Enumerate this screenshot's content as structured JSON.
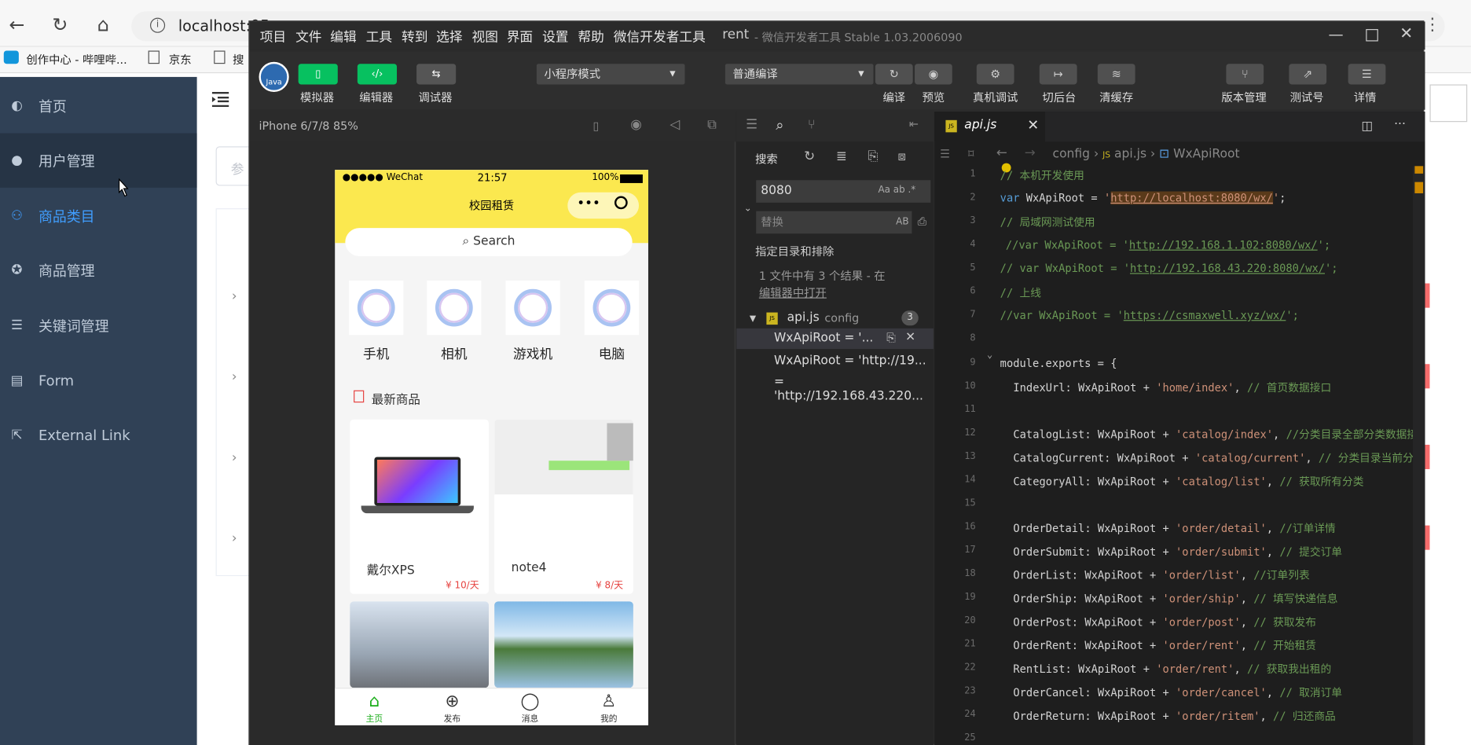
{
  "browser": {
    "url": "localhost:95",
    "bookmarks": [
      "创作中心 - 哔哩哔...",
      "京东",
      "搜"
    ]
  },
  "admin": {
    "sidebar": [
      {
        "label": "首页",
        "icon": "dashboard-icon"
      },
      {
        "label": "用户管理",
        "icon": "user-icon"
      },
      {
        "label": "商品类目",
        "icon": "tree-icon"
      },
      {
        "label": "商品管理",
        "icon": "goods-icon"
      },
      {
        "label": "关键词管理",
        "icon": "list-icon"
      },
      {
        "label": "Form",
        "icon": "form-icon"
      },
      {
        "label": "External Link",
        "icon": "link-icon"
      }
    ],
    "active_index": 2,
    "hover_index": 1,
    "search_placeholder": "参"
  },
  "devtools": {
    "menus": [
      "项目",
      "文件",
      "编辑",
      "工具",
      "转到",
      "选择",
      "视图",
      "界面",
      "设置",
      "帮助",
      "微信开发者工具"
    ],
    "title": "rent",
    "title_suffix": "- 微信开发者工具 Stable 1.03.2006090",
    "toolbar": {
      "simulator": "模拟器",
      "editor": "编辑器",
      "debugger": "调试器",
      "mode": "小程序模式",
      "compile": "普通编译",
      "compile_btn": "编译",
      "preview": "预览",
      "real_debug": "真机调试",
      "background": "切后台",
      "clear_cache": "清缓存",
      "version": "版本管理",
      "test": "测试号",
      "details": "详情"
    },
    "device": "iPhone 6/7/8 85%"
  },
  "phone": {
    "carrier": "●●●●● WeChat",
    "time": "21:57",
    "battery": "100%",
    "title": "校园租赁",
    "search": "Search",
    "categories": [
      "手机",
      "相机",
      "游戏机",
      "电脑"
    ],
    "section_title": "最新商品",
    "products": [
      {
        "name": "戴尔XPS",
        "price": "¥ 10/天"
      },
      {
        "name": "note4",
        "price": "¥ 8/天"
      }
    ],
    "tabs": [
      "主页",
      "发布",
      "消息",
      "我的"
    ]
  },
  "search": {
    "label": "搜索",
    "query": "8080",
    "replace_placeholder": "替换",
    "scope": "指定目录和排除",
    "summary": "1 文件中有 3 个结果 - 在",
    "open_link": "编辑器中打开",
    "file": "api.js",
    "folder": "config",
    "count": "3",
    "results": [
      "WxApiRoot = '...",
      "WxApiRoot = 'http://19...",
      "= 'http://192.168.43.220..."
    ]
  },
  "editor": {
    "tab": "api.js",
    "breadcrumb": [
      "config",
      "api.js",
      "WxApiRoot"
    ]
  }
}
